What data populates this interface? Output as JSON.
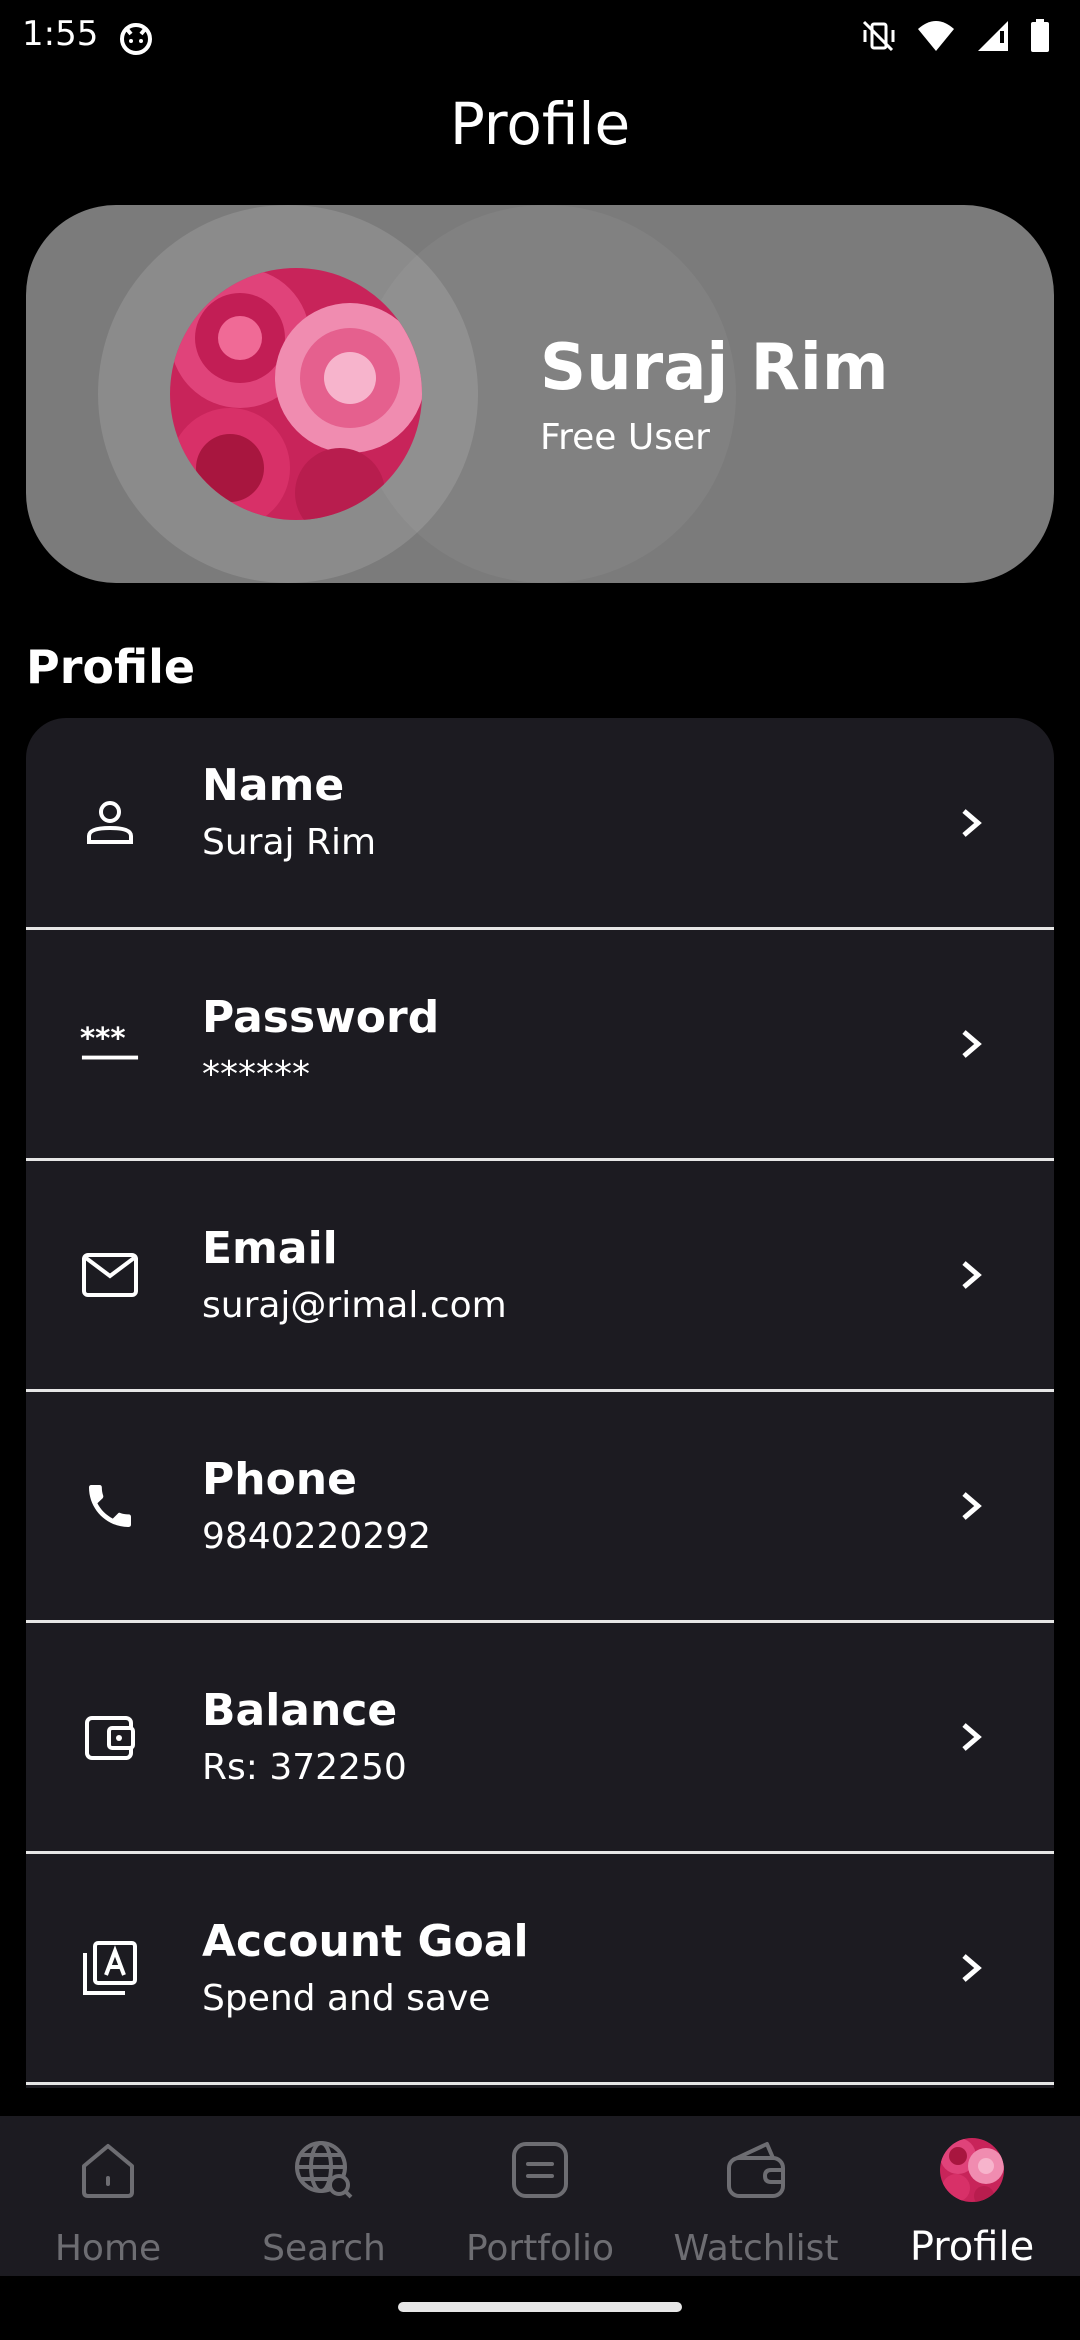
{
  "status_bar": {
    "time": "1:55",
    "icons": [
      "cat-notification-icon",
      "mute-vibrate-icon",
      "wifi-icon",
      "signal-icon",
      "battery-icon"
    ]
  },
  "header": {
    "title": "Profile"
  },
  "profile_card": {
    "name": "Suraj Rim",
    "subtitle": "Free User",
    "background_color": "#7b7b7b"
  },
  "section": {
    "title": "Profile"
  },
  "rows": [
    {
      "icon": "person-icon",
      "title": "Name",
      "value": "Suraj Rim"
    },
    {
      "icon": "password-icon",
      "title": "Password",
      "value": "******"
    },
    {
      "icon": "mail-icon",
      "title": "Email",
      "value": "suraj@rimal.com"
    },
    {
      "icon": "phone-icon",
      "title": "Phone",
      "value": "9840220292"
    },
    {
      "icon": "wallet-icon",
      "title": "Balance",
      "value": "Rs: 372250"
    },
    {
      "icon": "account-box-icon",
      "title": "Account Goal",
      "value": "Spend and save"
    }
  ],
  "bottom_nav": {
    "items": [
      {
        "icon": "home-icon",
        "label": "Home"
      },
      {
        "icon": "globe-search-icon",
        "label": "Search"
      },
      {
        "icon": "portfolio-icon",
        "label": "Portfolio"
      },
      {
        "icon": "wallet-icon",
        "label": "Watchlist"
      },
      {
        "icon": "avatar",
        "label": "Profile"
      }
    ],
    "active": "Profile",
    "inactive_color": "#6d6d72",
    "active_color": "#ffffff"
  },
  "colors": {
    "background": "#000000",
    "card": "#1c1b21",
    "divider": "#e6e6e6"
  }
}
